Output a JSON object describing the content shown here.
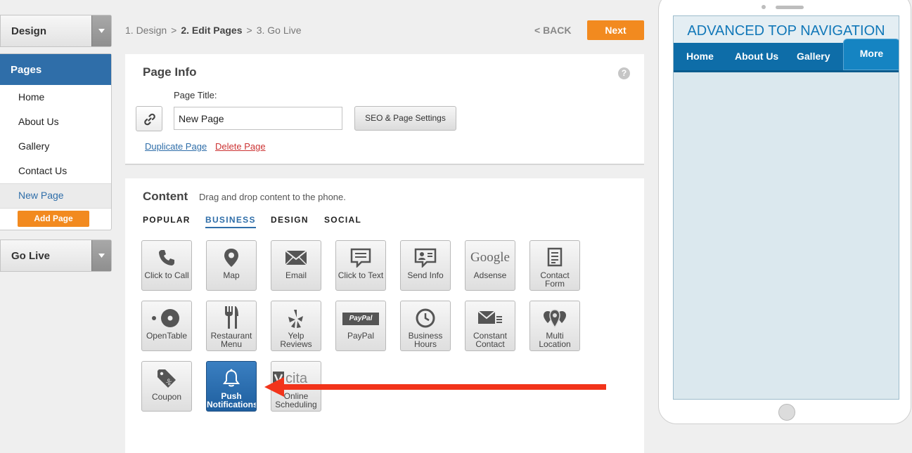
{
  "sidebar": {
    "design_label": "Design",
    "pages_header": "Pages",
    "pages": [
      "Home",
      "About Us",
      "Gallery",
      "Contact Us",
      "New Page"
    ],
    "add_page_label": "Add Page",
    "golive_label": "Go Live"
  },
  "breadcrumb": {
    "step1": "1. Design",
    "step2": "2. Edit Pages",
    "step3": "3. Go Live",
    "separator": ">"
  },
  "header": {
    "back_label": "< BACK",
    "next_label": "Next"
  },
  "page_info": {
    "title": "Page Info",
    "help_label": "?",
    "page_title_label": "Page Title:",
    "page_title_value": "New Page",
    "seo_button": "SEO & Page Settings",
    "duplicate_link": "Duplicate Page",
    "delete_link": "Delete Page"
  },
  "content": {
    "title": "Content",
    "subtitle": "Drag and drop content to the phone.",
    "tabs": [
      "POPULAR",
      "BUSINESS",
      "DESIGN",
      "SOCIAL"
    ],
    "active_tab": "BUSINESS",
    "tiles": [
      {
        "label_1": "Click to Call",
        "label_2": "",
        "icon": "phone-icon"
      },
      {
        "label_1": "Map",
        "label_2": "",
        "icon": "map-pin-icon"
      },
      {
        "label_1": "Email",
        "label_2": "",
        "icon": "envelope-icon"
      },
      {
        "label_1": "Click to Text",
        "label_2": "",
        "icon": "speech-bubble-icon"
      },
      {
        "label_1": "Send Info",
        "label_2": "",
        "icon": "contact-card-icon"
      },
      {
        "label_1": "Adsense",
        "label_2": "",
        "icon": "google-logo-icon",
        "logo_text": "Google"
      },
      {
        "label_1": "Contact",
        "label_2": "Form",
        "icon": "form-icon"
      },
      {
        "label_1": "OpenTable",
        "label_2": "",
        "icon": "opentable-icon"
      },
      {
        "label_1": "Restaurant",
        "label_2": "Menu",
        "icon": "fork-knife-icon"
      },
      {
        "label_1": "Yelp",
        "label_2": "Reviews",
        "icon": "yelp-icon"
      },
      {
        "label_1": "PayPal",
        "label_2": "",
        "icon": "paypal-icon",
        "logo_text": "PayPal"
      },
      {
        "label_1": "Business",
        "label_2": "Hours",
        "icon": "clock-icon"
      },
      {
        "label_1": "Constant",
        "label_2": "Contact",
        "icon": "constant-contact-icon"
      },
      {
        "label_1": "Multi",
        "label_2": "Location",
        "icon": "multi-pin-icon"
      },
      {
        "label_1": "Coupon",
        "label_2": "",
        "icon": "coupon-tag-icon"
      },
      {
        "label_1": "Push",
        "label_2": "Notifications",
        "icon": "bell-icon"
      },
      {
        "label_1": "Online",
        "label_2": "Scheduling",
        "icon": "vcita-icon",
        "logo_text": "cita"
      }
    ]
  },
  "phone": {
    "app_title": "ADVANCED TOP NAVIGATION",
    "nav": [
      "Home",
      "About Us",
      "Gallery"
    ],
    "more_label": "More"
  },
  "colors": {
    "accent_blue": "#2f6ea9",
    "orange": "#f28a1f",
    "nav_blue": "#0e6da8",
    "arrow_red": "#f2341b"
  }
}
